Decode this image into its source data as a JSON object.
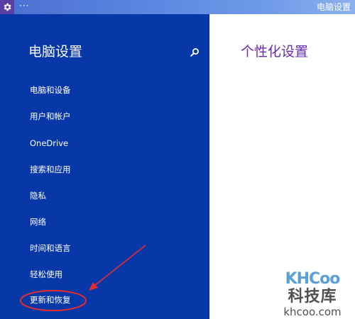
{
  "titlebar": {
    "ellipsis": "···",
    "title": "电脑设置"
  },
  "left_pane": {
    "title": "电脑设置",
    "search_icon": "search-icon",
    "items": [
      {
        "label": "电脑和设备"
      },
      {
        "label": "用户和帐户"
      },
      {
        "label": "OneDrive"
      },
      {
        "label": "搜索和应用"
      },
      {
        "label": "隐私"
      },
      {
        "label": "网络"
      },
      {
        "label": "时间和语言"
      },
      {
        "label": "轻松使用"
      },
      {
        "label": "更新和恢复"
      }
    ]
  },
  "right_pane": {
    "heading": "个性化设置"
  },
  "watermark": {
    "logo": "KHCoo",
    "name": "科技库",
    "url": "khcoo.com"
  },
  "colors": {
    "pane_blue": "#0838a8",
    "heading_purple": "#6a2bb0",
    "annotation_red": "#e52d2d",
    "titlebar": "#5b85e0"
  }
}
